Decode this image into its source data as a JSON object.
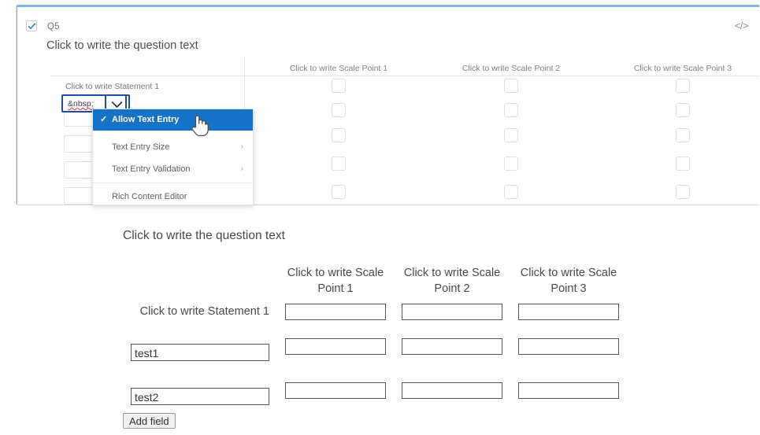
{
  "editor": {
    "question_number": "Q5",
    "question_text": "Click to write the question text",
    "code_icon": "</>",
    "checkbox_icon": "checkmark-icon",
    "scale_points": [
      "Click to write Scale Point 1",
      "Click to write Scale Point 2",
      "Click to write Scale Point 3"
    ],
    "statement_label": "Click to write Statement 1",
    "combo_value": "&nbsp;",
    "combo_arrow_icon": "chevron-down-icon",
    "row_count": 5,
    "column_count": 3
  },
  "dropdown": {
    "items": [
      {
        "label": "Allow Text Entry",
        "selected": true,
        "has_submenu": false,
        "check_icon": "check-icon"
      },
      {
        "label": "Text Entry Size",
        "selected": false,
        "has_submenu": true,
        "chevron": "›"
      },
      {
        "label": "Text Entry Validation",
        "selected": false,
        "has_submenu": true,
        "chevron": "›"
      },
      {
        "label": "Rich Content Editor",
        "selected": false,
        "has_submenu": false
      }
    ],
    "highlight_color": "#1572c6",
    "cursor_icon": "pointing-hand-cursor"
  },
  "preview": {
    "question_text": "Click to write the question text",
    "scale_points": [
      "Click to write Scale\nPoint 1",
      "Click to write Scale\nPoint 2",
      "Click to write Scale\nPoint 3"
    ],
    "statement_label": "Click to write Statement 1",
    "statement_inputs": [
      {
        "value": "test1"
      },
      {
        "value": "test2"
      }
    ],
    "add_field_label": "Add field"
  }
}
